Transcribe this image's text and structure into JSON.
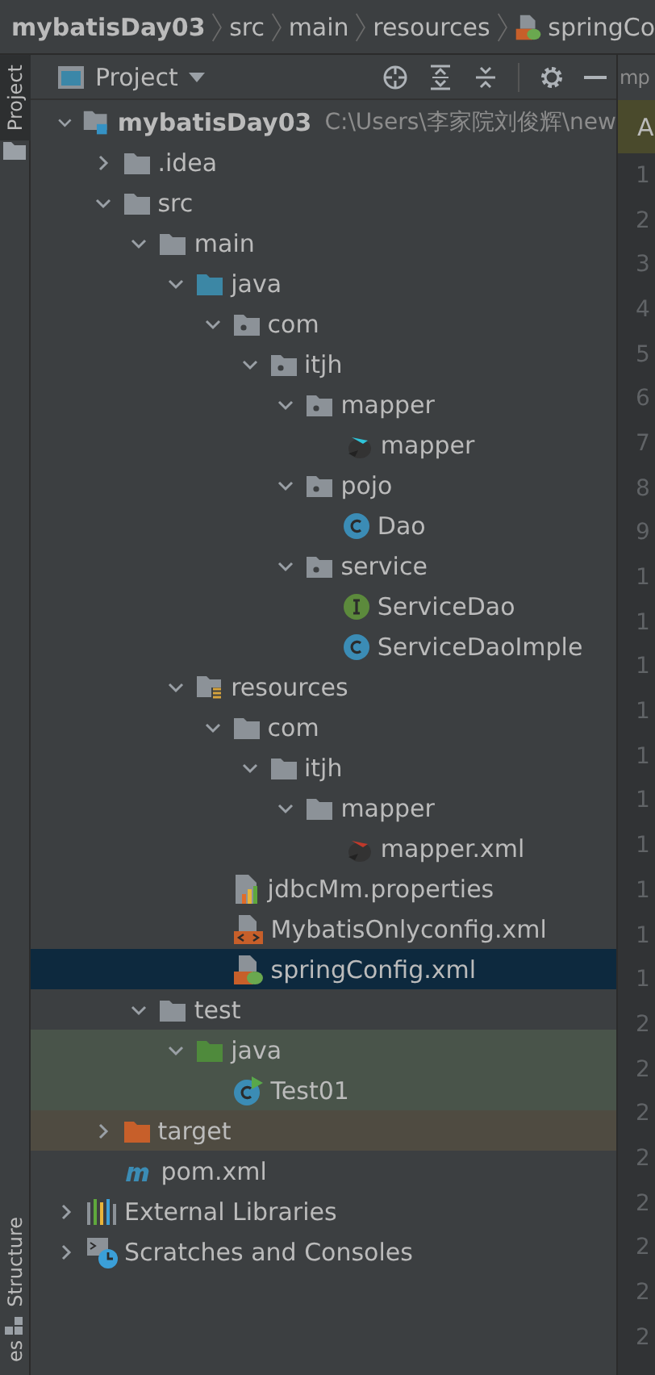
{
  "breadcrumb": [
    {
      "label": "mybatisDay03",
      "kind": "module"
    },
    {
      "label": "src",
      "kind": "plain"
    },
    {
      "label": "main",
      "kind": "plain"
    },
    {
      "label": "resources",
      "kind": "plain"
    },
    {
      "label": "springCo",
      "kind": "spring-xml"
    }
  ],
  "left_stripe": {
    "top_tab": {
      "label": "Project",
      "selected": true
    },
    "bottom_tab": {
      "label": "Structure"
    },
    "cut_tab": {
      "label": "es"
    }
  },
  "panel": {
    "title": "Project"
  },
  "tree": [
    {
      "label": "mybatisDay03",
      "path": "C:\\Users\\李家院刘俊辉\\new",
      "kind": "module",
      "expanded": true,
      "children": [
        {
          "label": ".idea",
          "kind": "folder",
          "expanded": false
        },
        {
          "label": "src",
          "kind": "folder",
          "expanded": true,
          "children": [
            {
              "label": "main",
              "kind": "folder",
              "expanded": true,
              "children": [
                {
                  "label": "java",
                  "kind": "source-folder",
                  "expanded": true,
                  "children": [
                    {
                      "label": "com",
                      "kind": "package",
                      "expanded": true,
                      "children": [
                        {
                          "label": "itjh",
                          "kind": "package",
                          "expanded": true,
                          "children": [
                            {
                              "label": "mapper",
                              "kind": "package",
                              "expanded": true,
                              "children": [
                                {
                                  "label": "mapper",
                                  "kind": "mybatis-mapper"
                                }
                              ]
                            },
                            {
                              "label": "pojo",
                              "kind": "package",
                              "expanded": true,
                              "children": [
                                {
                                  "label": "Dao",
                                  "kind": "class"
                                }
                              ]
                            },
                            {
                              "label": "service",
                              "kind": "package",
                              "expanded": true,
                              "children": [
                                {
                                  "label": "ServiceDao",
                                  "kind": "interface"
                                },
                                {
                                  "label": "ServiceDaoImple",
                                  "kind": "class"
                                }
                              ]
                            }
                          ]
                        }
                      ]
                    }
                  ]
                },
                {
                  "label": "resources",
                  "kind": "resource-folder",
                  "expanded": true,
                  "children": [
                    {
                      "label": "com",
                      "kind": "folder",
                      "expanded": true,
                      "children": [
                        {
                          "label": "itjh",
                          "kind": "folder",
                          "expanded": true,
                          "children": [
                            {
                              "label": "mapper",
                              "kind": "folder",
                              "expanded": true,
                              "children": [
                                {
                                  "label": "mapper.xml",
                                  "kind": "mybatis-xml"
                                }
                              ]
                            }
                          ]
                        }
                      ]
                    },
                    {
                      "label": "jdbcMm.properties",
                      "kind": "properties"
                    },
                    {
                      "label": "MybatisOnlyconfig.xml",
                      "kind": "xml"
                    },
                    {
                      "label": "springConfig.xml",
                      "kind": "spring-xml",
                      "selected": true
                    }
                  ]
                }
              ]
            },
            {
              "label": "test",
              "kind": "folder",
              "expanded": true,
              "children": [
                {
                  "label": "java",
                  "kind": "test-folder",
                  "expanded": true,
                  "children": [
                    {
                      "label": "Test01",
                      "kind": "test-class"
                    }
                  ]
                }
              ]
            }
          ]
        },
        {
          "label": "target",
          "kind": "excluded-folder",
          "expanded": false
        },
        {
          "label": "pom.xml",
          "kind": "maven"
        }
      ]
    },
    {
      "label": "External Libraries",
      "kind": "libraries",
      "expanded": false
    },
    {
      "label": "Scratches and Consoles",
      "kind": "scratches",
      "expanded": false
    }
  ],
  "editor": {
    "tab": "mp",
    "banner": "A",
    "line_numbers": [
      "1",
      "2",
      "3",
      "4",
      "5",
      "6",
      "7",
      "8",
      "9",
      "1",
      "1",
      "1",
      "1",
      "1",
      "1",
      "1",
      "1",
      "1",
      "1",
      "2",
      "2",
      "2",
      "2",
      "2",
      "2",
      "2",
      "2"
    ]
  }
}
